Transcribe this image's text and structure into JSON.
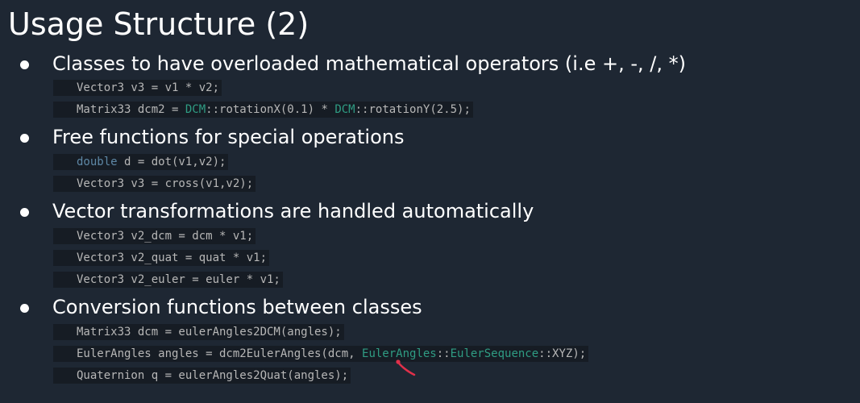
{
  "title": "Usage Structure (2)",
  "colors": {
    "background": "#1e2733",
    "code_background": "#161c24",
    "code_text": "#b7b7b7",
    "keyword": "#5e88a6",
    "type_name": "#2f9c83",
    "annotation_arrow": "#e0304a"
  },
  "bullets": [
    {
      "text": "Classes to have overloaded mathematical operators (i.e +, -, /, *)",
      "code": [
        [
          {
            "t": "Vector3 v3 = v1 * v2;"
          }
        ],
        [
          {
            "t": "Matrix33 dcm2 = "
          },
          {
            "t": "DCM",
            "c": "ty"
          },
          {
            "t": "::rotationX(0.1) * "
          },
          {
            "t": "DCM",
            "c": "ty"
          },
          {
            "t": "::rotationY(2.5);"
          }
        ]
      ]
    },
    {
      "text": "Free functions for special operations",
      "code": [
        [
          {
            "t": "double",
            "c": "kw"
          },
          {
            "t": " d = dot(v1,v2);"
          }
        ],
        [
          {
            "t": "Vector3 v3 = cross(v1,v2);"
          }
        ]
      ]
    },
    {
      "text": "Vector transformations are handled automatically",
      "code": [
        [
          {
            "t": "Vector3 v2_dcm = dcm * v1;"
          }
        ],
        [
          {
            "t": "Vector3 v2_quat = quat * v1;"
          }
        ],
        [
          {
            "t": "Vector3 v2_euler = euler * v1;"
          }
        ]
      ]
    },
    {
      "text": "Conversion functions between classes",
      "code": [
        [
          {
            "t": "Matrix33 dcm = eulerAngles2DCM(angles);"
          }
        ],
        [
          {
            "t": "EulerAngles angles = dcm2EulerAngles(dcm, "
          },
          {
            "t": "EulerAngles",
            "c": "ty"
          },
          {
            "t": "::"
          },
          {
            "t": "EulerSequence",
            "c": "ty"
          },
          {
            "t": "::XYZ);"
          }
        ],
        [
          {
            "t": "Quaternion q = eulerAngles2Quat(angles);"
          }
        ]
      ]
    }
  ]
}
